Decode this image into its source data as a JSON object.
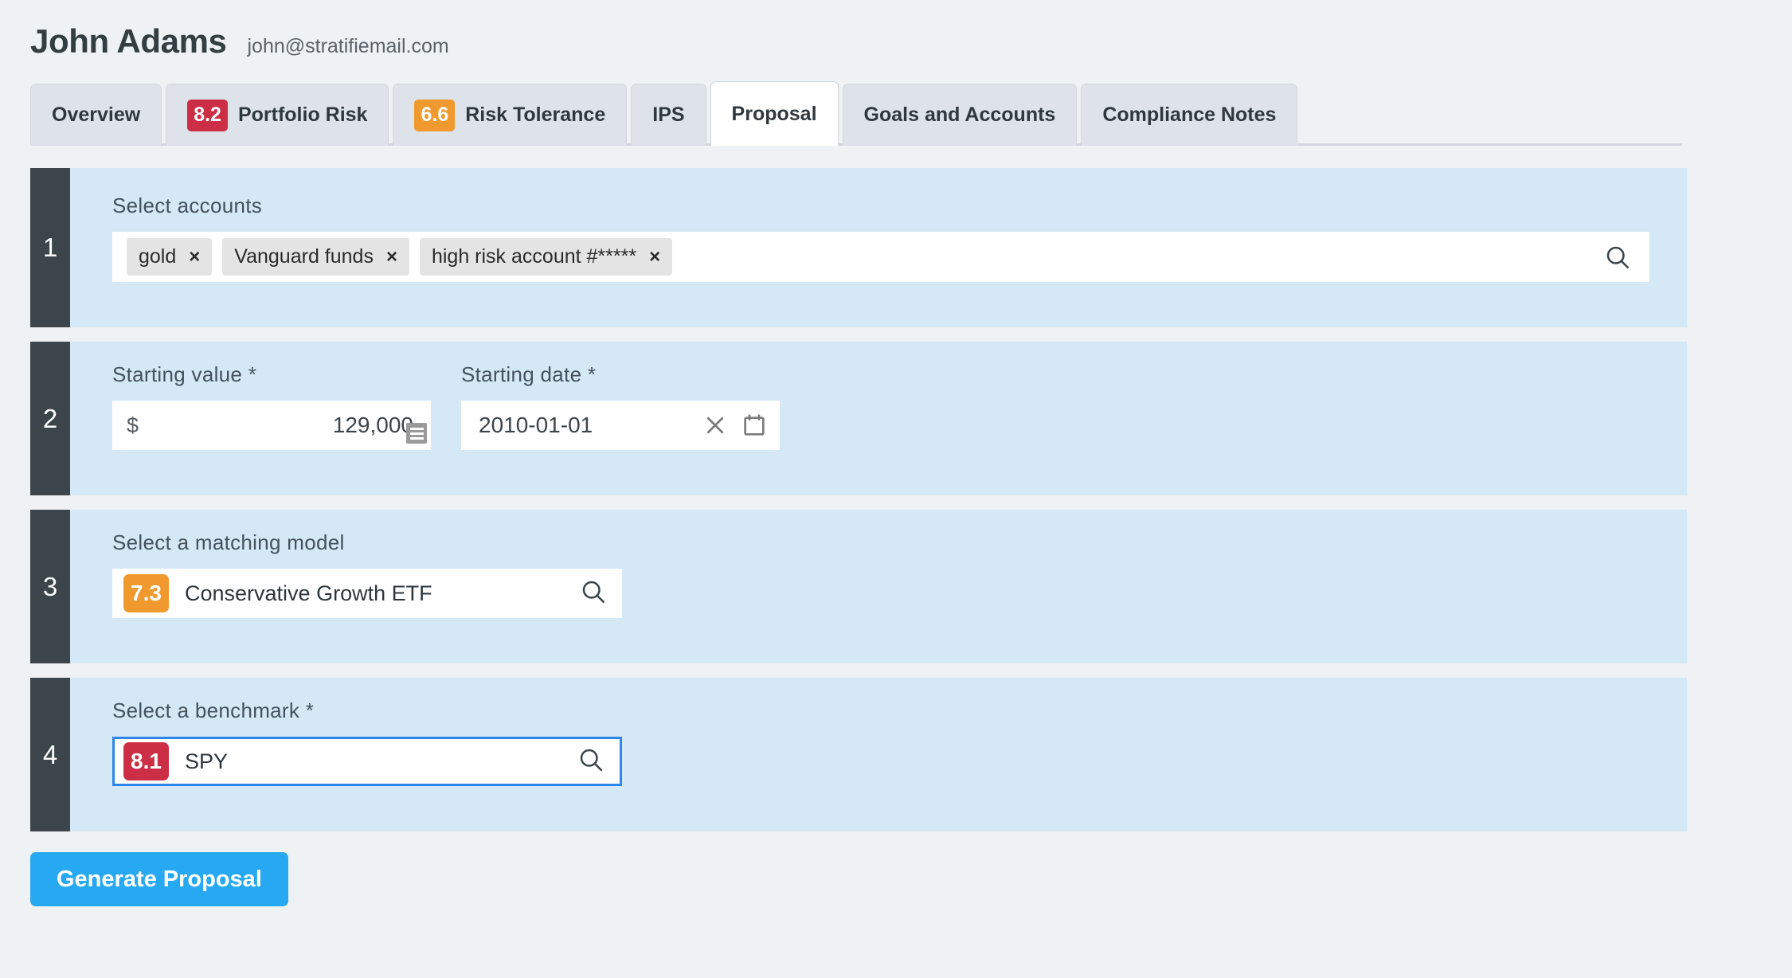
{
  "header": {
    "client_name": "John Adams",
    "client_email": "john@stratifiemail.com"
  },
  "tabs": [
    {
      "label": "Overview",
      "score": null,
      "score_color": null,
      "active": false
    },
    {
      "label": "Portfolio Risk",
      "score": "8.2",
      "score_color": "#cc2f45",
      "active": false
    },
    {
      "label": "Risk Tolerance",
      "score": "6.6",
      "score_color": "#f0992e",
      "active": false
    },
    {
      "label": "IPS",
      "score": null,
      "score_color": null,
      "active": false
    },
    {
      "label": "Proposal",
      "score": null,
      "score_color": null,
      "active": true
    },
    {
      "label": "Goals and Accounts",
      "score": null,
      "score_color": null,
      "active": false
    },
    {
      "label": "Compliance Notes",
      "score": null,
      "score_color": null,
      "active": false
    }
  ],
  "steps": {
    "one": {
      "number": "1",
      "label": "Select accounts",
      "chips": [
        {
          "text": "gold",
          "remove": "×"
        },
        {
          "text": "Vanguard funds",
          "remove": "×"
        },
        {
          "text": "high risk account #*****",
          "remove": "×"
        }
      ],
      "search_icon": "search-icon",
      "input_placeholder": ""
    },
    "two": {
      "number": "2",
      "value_label": "Starting value *",
      "currency_symbol": "$",
      "value": "129,000",
      "date_label": "Starting date *",
      "date_value": "2010-01-01",
      "date_placeholder": "YYYY-MM-DD",
      "clear_icon": "close-icon",
      "calendar_icon": "calendar-icon",
      "resize_icon": "resize-grip-icon"
    },
    "three": {
      "number": "3",
      "label": "Select a matching model",
      "score": "7.3",
      "score_color": "#f0992e",
      "value": "Conservative Growth ETF",
      "search_icon": "search-icon"
    },
    "four": {
      "number": "4",
      "label": "Select a benchmark *",
      "score": "8.1",
      "score_color": "#cc2f45",
      "value": "SPY",
      "search_icon": "search-icon",
      "focused": true,
      "focus_color": "#2f86e8"
    }
  },
  "actions": {
    "generate_label": "Generate Proposal",
    "generate_color": "#27a9f1"
  },
  "colors": {
    "page_bg": "#eff2f4",
    "section_bg": "#d4e8f5",
    "step_marker_bg": "#3b454a",
    "tab_bg": "#dee2e9",
    "tab_active_bg": "#ffffff"
  }
}
